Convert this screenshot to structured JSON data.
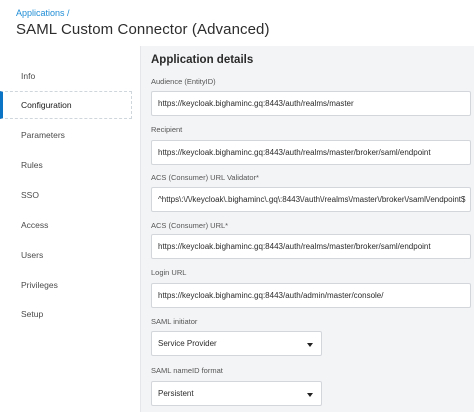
{
  "header": {
    "breadcrumb_link": "Applications",
    "breadcrumb_sep": "/",
    "title": "SAML Custom Connector (Advanced)"
  },
  "sidebar": {
    "items": [
      {
        "label": "Info",
        "active": false
      },
      {
        "label": "Configuration",
        "active": true
      },
      {
        "label": "Parameters",
        "active": false
      },
      {
        "label": "Rules",
        "active": false
      },
      {
        "label": "SSO",
        "active": false
      },
      {
        "label": "Access",
        "active": false
      },
      {
        "label": "Users",
        "active": false
      },
      {
        "label": "Privileges",
        "active": false
      },
      {
        "label": "Setup",
        "active": false
      }
    ]
  },
  "main": {
    "section_title": "Application details",
    "fields": {
      "audience": {
        "label": "Audience (EntityID)",
        "value": "https://keycloak.bighaminc.gq:8443/auth/realms/master"
      },
      "recipient": {
        "label": "Recipient",
        "value": "https://keycloak.bighaminc.gq:8443/auth/realms/master/broker/saml/endpoint"
      },
      "acs_validator": {
        "label": "ACS (Consumer) URL Validator*",
        "value": "^https\\:\\/\\/keycloak\\.bighaminc\\.gq\\:8443\\/auth\\/realms\\/master\\/broker\\/saml\\/endpoint$"
      },
      "acs_url": {
        "label": "ACS (Consumer) URL*",
        "value": "https://keycloak.bighaminc.gq:8443/auth/realms/master/broker/saml/endpoint"
      },
      "login_url": {
        "label": "Login URL",
        "value": "https://keycloak.bighaminc.gq:8443/auth/admin/master/console/"
      },
      "saml_initiator": {
        "label": "SAML initiator",
        "value": "Service Provider"
      },
      "nameid_format": {
        "label": "SAML nameID format",
        "value": "Persistent"
      }
    }
  },
  "colors": {
    "accent": "#0b74c5",
    "link": "#1f8dd6",
    "panel_bg": "#f3f4f6"
  }
}
